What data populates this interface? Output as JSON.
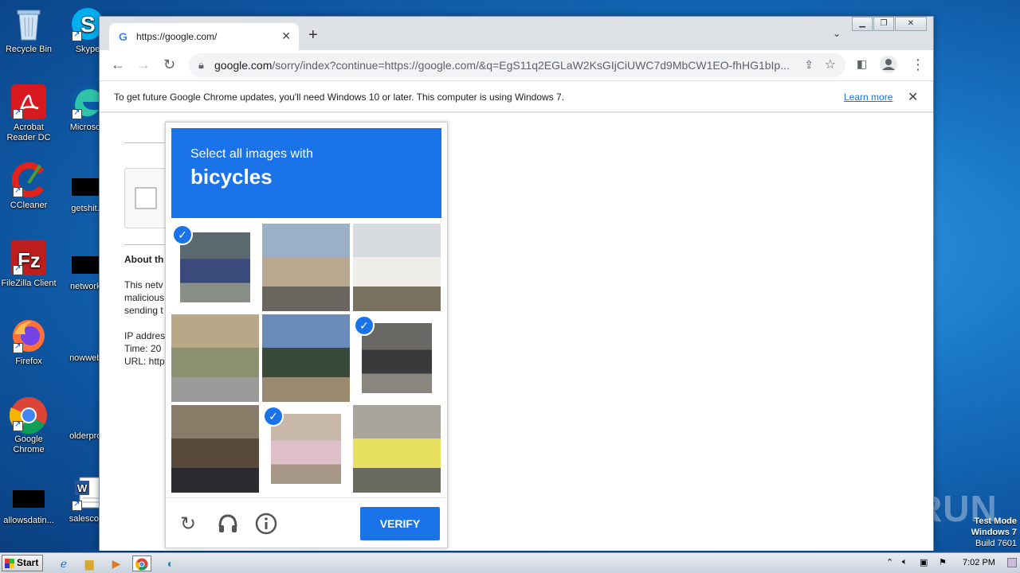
{
  "desktop": {
    "icons": [
      {
        "label": "Recycle Bin"
      },
      {
        "label": "Skype"
      },
      {
        "label": "Acrobat Reader DC"
      },
      {
        "label": "Microsoft"
      },
      {
        "label": "CCleaner"
      },
      {
        "label": "getshit..."
      },
      {
        "label": "FileZilla Client"
      },
      {
        "label": "networkc"
      },
      {
        "label": "Firefox"
      },
      {
        "label": "nowwebs"
      },
      {
        "label": "Google Chrome"
      },
      {
        "label": "olderprov"
      },
      {
        "label": "allowsdatin..."
      },
      {
        "label": "salescont"
      }
    ],
    "watermark": "ANY RUN",
    "test_mode": {
      "line1": "Test Mode",
      "line2": "Windows 7",
      "line3": "Build 7601"
    }
  },
  "browser": {
    "tab_title": "https://google.com/",
    "url_host": "google.com",
    "url_rest": "/sorry/index?continue=https://google.com/&q=EgS11q2EGLaW2KsGIjCiUWC7d9MbCW1EO-fhHG1bIp...",
    "infobar": {
      "message": "To get future Google Chrome updates, you'll need Windows 10 or later. This computer is using Windows 7.",
      "link": "Learn more"
    }
  },
  "page": {
    "about": "About th",
    "para": [
      "This netv",
      "malicious",
      "sending t"
    ],
    "details": [
      "IP addres",
      "Time: 20",
      "URL: http"
    ]
  },
  "captcha": {
    "instruction": "Select all images with",
    "target": "bicycles",
    "verify_label": "VERIFY",
    "tiles": [
      {
        "selected": true,
        "colors": [
          "#5a6a70",
          "#3a4a7a",
          "#8a9088"
        ]
      },
      {
        "selected": false,
        "colors": [
          "#9ab0c8",
          "#b8a890",
          "#6a6660"
        ]
      },
      {
        "selected": false,
        "colors": [
          "#d8dce0",
          "#f0eeea",
          "#7a7060"
        ]
      },
      {
        "selected": false,
        "colors": [
          "#b8a888",
          "#8a9070",
          "#9a9a98"
        ]
      },
      {
        "selected": false,
        "colors": [
          "#6a8ab8",
          "#3a4a3a",
          "#9a8a70"
        ]
      },
      {
        "selected": true,
        "colors": [
          "#6a6864",
          "#3a3a3c",
          "#8a8680"
        ]
      },
      {
        "selected": false,
        "colors": [
          "#8a7a68",
          "#5a4a3c",
          "#2a2a30"
        ]
      },
      {
        "selected": true,
        "colors": [
          "#c8b8a8",
          "#e0c0c8",
          "#a89888"
        ]
      },
      {
        "selected": false,
        "colors": [
          "#a8a49c",
          "#e8e060",
          "#6a6a60"
        ]
      }
    ]
  },
  "taskbar": {
    "start": "Start",
    "clock": "7:02 PM"
  }
}
